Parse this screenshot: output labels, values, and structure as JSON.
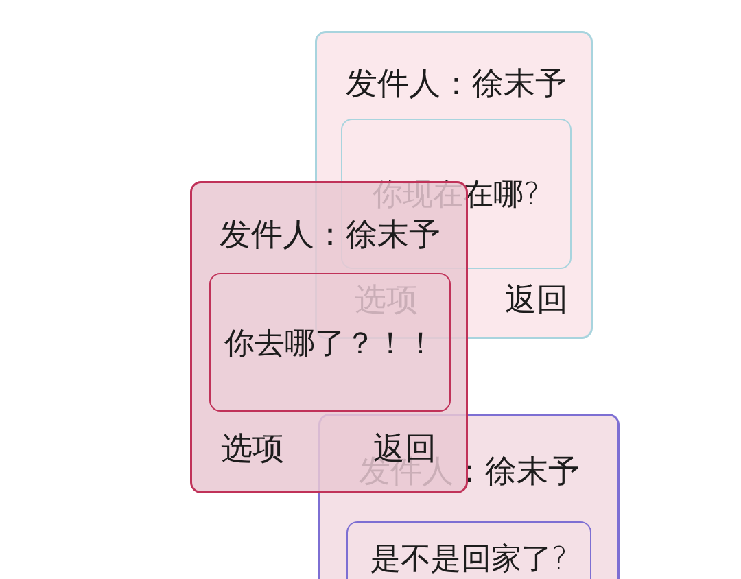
{
  "cards": [
    {
      "color": "#a8d4de",
      "sender": "发件人：徐末予",
      "message": "你现在在哪?",
      "actions": [
        "选项",
        "返回"
      ]
    },
    {
      "color": "#c03259",
      "sender": "发件人：徐末予",
      "message": "你去哪了？！！",
      "actions": [
        "选项",
        "返回"
      ]
    },
    {
      "color": "#7d6fd3",
      "sender": "发件人：徐末予",
      "message": "是不是回家了?"
    }
  ]
}
